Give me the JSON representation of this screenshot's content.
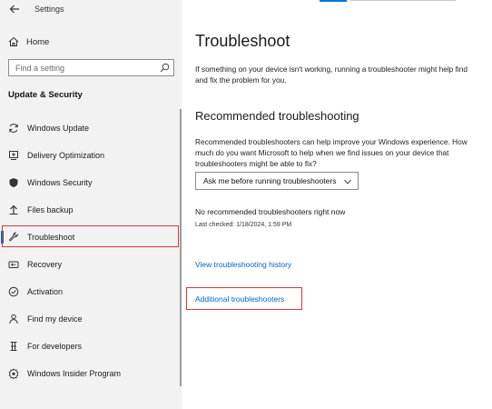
{
  "window": {
    "title": "Settings"
  },
  "sidebar": {
    "home_label": "Home",
    "search_placeholder": "Find a setting",
    "section_title": "Update & Security",
    "items": [
      {
        "label": "Windows Update",
        "icon": "sync-icon"
      },
      {
        "label": "Delivery Optimization",
        "icon": "delivery-optimization-icon"
      },
      {
        "label": "Windows Security",
        "icon": "shield-icon"
      },
      {
        "label": "Files backup",
        "icon": "backup-arrow-icon"
      },
      {
        "label": "Troubleshoot",
        "icon": "wrench-icon",
        "active": true
      },
      {
        "label": "Recovery",
        "icon": "recovery-icon"
      },
      {
        "label": "Activation",
        "icon": "check-circle-icon"
      },
      {
        "label": "Find my device",
        "icon": "person-location-icon"
      },
      {
        "label": "For developers",
        "icon": "developer-tools-icon"
      },
      {
        "label": "Windows Insider Program",
        "icon": "insider-icon"
      }
    ]
  },
  "main": {
    "title": "Troubleshoot",
    "intro": "If something on your device isn't working, running a troubleshooter might help find and fix the problem for you.",
    "recommended_heading": "Recommended troubleshooting",
    "recommended_desc": "Recommended troubleshooters can help improve your Windows experience. How much do you want Microsoft to help when we find issues on your device that troubleshooters might be able to fix?",
    "dropdown_selected": "Ask me before running troubleshooters",
    "no_recommended": "No recommended troubleshooters right now",
    "last_checked": "Last checked: 1/18/2024, 1:59 PM",
    "history_link": "View troubleshooting history",
    "additional_link": "Additional troubleshooters"
  },
  "colors": {
    "accent": "#0067c0",
    "highlight": "#d23a3a",
    "sidebar_bg": "#f2f2f2"
  }
}
